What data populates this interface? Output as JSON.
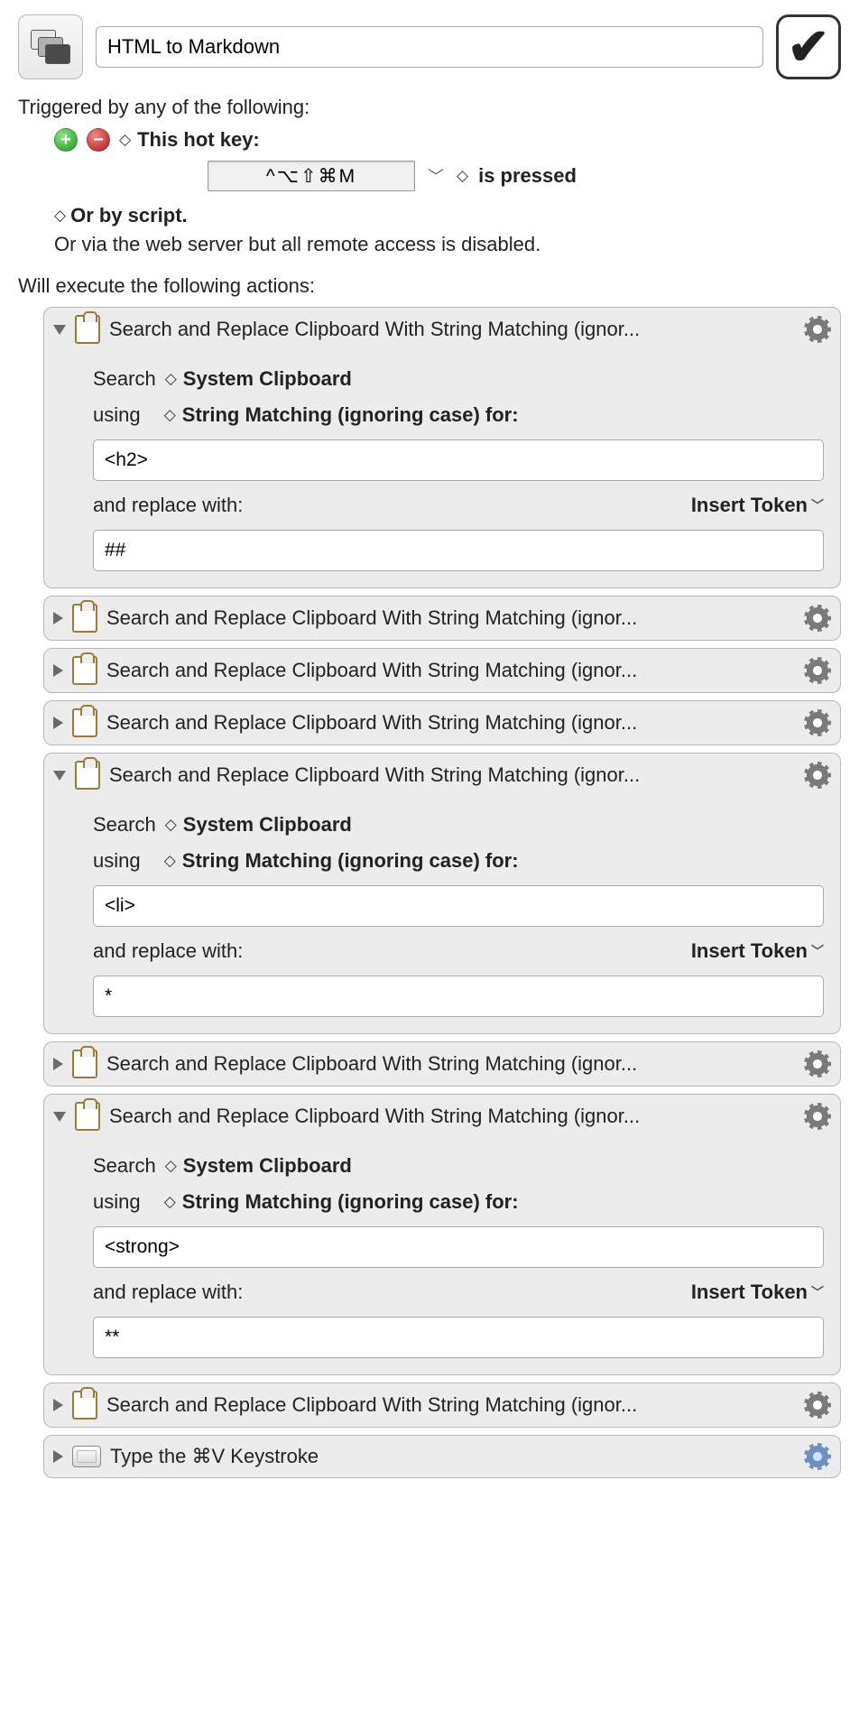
{
  "header": {
    "title": "HTML to Markdown"
  },
  "triggers": {
    "heading": "Triggered by any of the following:",
    "hotkey_label": "This hot key:",
    "hotkey_value": "^⌥⇧⌘M",
    "pressed_label": "is pressed",
    "script_label": "Or by script.",
    "remote_label": "Or via the web server but all remote access is disabled."
  },
  "actions_heading": "Will execute the following actions:",
  "labels": {
    "search": "Search",
    "system_clipboard": "System Clipboard",
    "using": "using",
    "matching": "String Matching (ignoring case) for:",
    "replace_with": "and replace with:",
    "insert_token": "Insert Token"
  },
  "actions": [
    {
      "expanded": true,
      "icon": "clipboard",
      "title": "Search and Replace Clipboard With String Matching (ignor...",
      "search_for": "<h2>",
      "replace_with": "##"
    },
    {
      "expanded": false,
      "icon": "clipboard",
      "title": "Search and Replace Clipboard With String Matching (ignor..."
    },
    {
      "expanded": false,
      "icon": "clipboard",
      "title": "Search and Replace Clipboard With String Matching (ignor..."
    },
    {
      "expanded": false,
      "icon": "clipboard",
      "title": "Search and Replace Clipboard With String Matching (ignor..."
    },
    {
      "expanded": true,
      "icon": "clipboard",
      "title": "Search and Replace Clipboard With String Matching (ignor...",
      "search_for": "<li>",
      "replace_with": "*"
    },
    {
      "expanded": false,
      "icon": "clipboard",
      "title": "Search and Replace Clipboard With String Matching (ignor..."
    },
    {
      "expanded": true,
      "icon": "clipboard",
      "title": "Search and Replace Clipboard With String Matching (ignor...",
      "search_for": "<strong>",
      "replace_with": "**"
    },
    {
      "expanded": false,
      "icon": "clipboard",
      "title": "Search and Replace Clipboard With String Matching (ignor..."
    },
    {
      "expanded": false,
      "icon": "keyboard",
      "title": "Type the ⌘V Keystroke",
      "gear": "blue"
    }
  ]
}
